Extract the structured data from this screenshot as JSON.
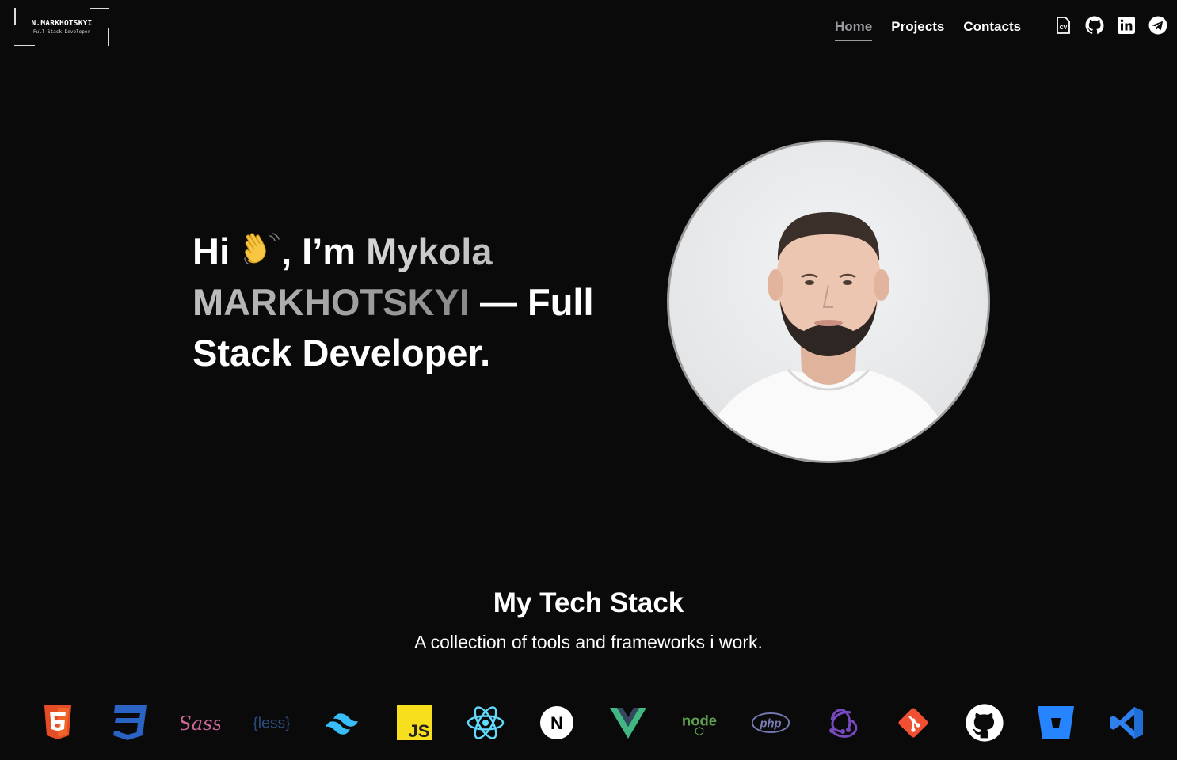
{
  "header": {
    "logo_name": "N.MARKHOTSKYI",
    "logo_role": "Full Stack Developer",
    "nav": [
      {
        "label": "Home",
        "active": true
      },
      {
        "label": "Projects",
        "active": false
      },
      {
        "label": "Contacts",
        "active": false
      }
    ],
    "socials": [
      "cv-icon",
      "github-icon",
      "linkedin-icon",
      "telegram-icon"
    ],
    "cv_label": "CV"
  },
  "hero": {
    "greeting": "Hi",
    "greeting_rest": ", I’m",
    "name": "Mykola MARKHOTSKYI",
    "dash": "—",
    "role": "Full Stack Developer.",
    "wave_icon": "waving-hand-icon",
    "avatar": "profile-photo"
  },
  "stack": {
    "title": "My Tech Stack",
    "subtitle": "A collection of tools and frameworks i work.",
    "icons": [
      "html5-icon",
      "css3-icon",
      "sass-icon",
      "less-icon",
      "tailwind-icon",
      "javascript-icon",
      "react-icon",
      "nextjs-icon",
      "vue-icon",
      "nodejs-icon",
      "php-icon",
      "redux-icon",
      "git-icon",
      "github-icon",
      "bitbucket-icon",
      "vscode-icon"
    ],
    "less_text": "{less}",
    "js_text": "JS",
    "node_text": "node",
    "php_text": "php",
    "sass_text": "Sass",
    "next_text": "N"
  },
  "colors": {
    "background": "#0a0a0b",
    "accent_gray": "#9a9a9f",
    "html5": "#e44d26",
    "css3": "#2a63c4",
    "sass": "#cd6799",
    "less": "#1d365d",
    "tailwind": "#38bdf8",
    "javascript": "#f7df1e",
    "react": "#61dafb",
    "vue": "#41b883",
    "node": "#5fa04e",
    "php": "#777bb3",
    "redux": "#764abc",
    "git": "#f05032",
    "bitbucket": "#2684ff",
    "vscode": "#2f80ed"
  }
}
